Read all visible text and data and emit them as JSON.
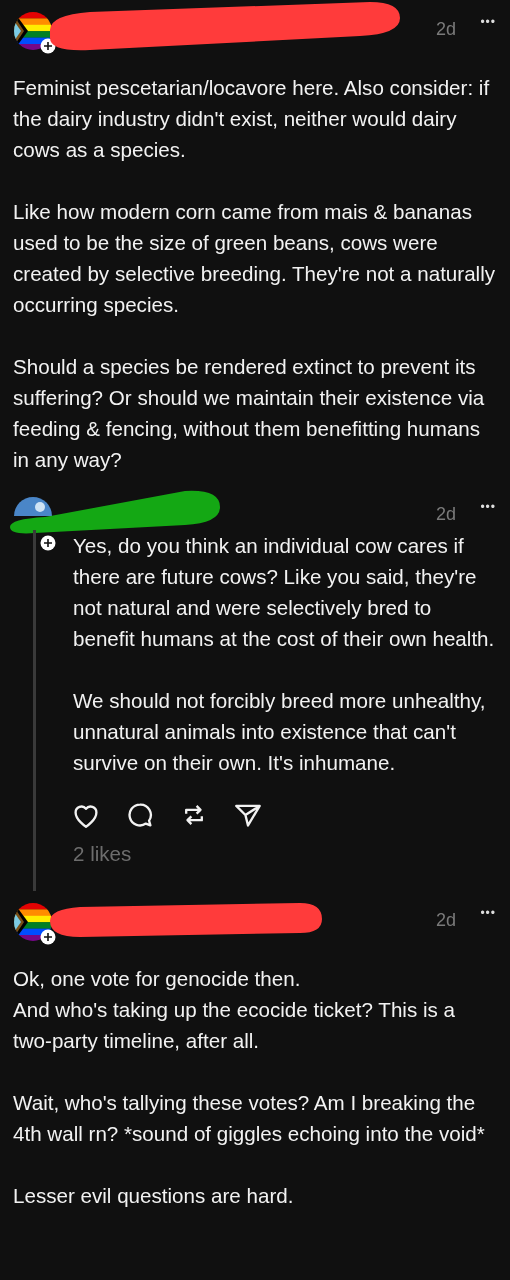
{
  "posts": [
    {
      "avatar": {
        "kind": "pride-flag"
      },
      "redaction": {
        "color": "#ff3b3b"
      },
      "time": "2d",
      "more": "•••",
      "reply": false,
      "paragraphs": [
        "Feminist pescetarian/locavore here. Also consider: if the dairy industry didn't exist, neither would dairy cows as a species.",
        "Like how modern corn came from mais & bananas used to be the size of green beans, cows were created by selective breeding. They're not a naturally occurring species.",
        "Should a species be rendered extinct to prevent its suffering? Or should we maintain their existence via feeding & fencing, without them benefitting humans in any way?"
      ]
    },
    {
      "avatar": {
        "kind": "picture"
      },
      "redaction": {
        "color": "#14a814"
      },
      "time": "2d",
      "more": "•••",
      "reply": true,
      "paragraphs": [
        "Yes, do you think an individual cow cares if there are future cows? Like you said, they're not natural and were selectively bred to benefit humans at the cost of their own health.",
        "We should not forcibly breed more unhealthy, unnatural animals into existence that can't survive on their own. It's inhumane."
      ],
      "likes": "2 likes"
    },
    {
      "avatar": {
        "kind": "pride-flag"
      },
      "redaction": {
        "color": "#ff3b3b"
      },
      "time": "2d",
      "more": "•••",
      "reply": false,
      "paragraphs": [
        "Ok, one vote for genocide then.\nAnd who's taking up the ecocide ticket? This is a two-party timeline, after all.",
        "Wait, who's tallying these votes? Am I breaking the 4th wall rn? *sound of giggles echoing into the void*",
        "Lesser evil questions are hard."
      ]
    }
  ]
}
